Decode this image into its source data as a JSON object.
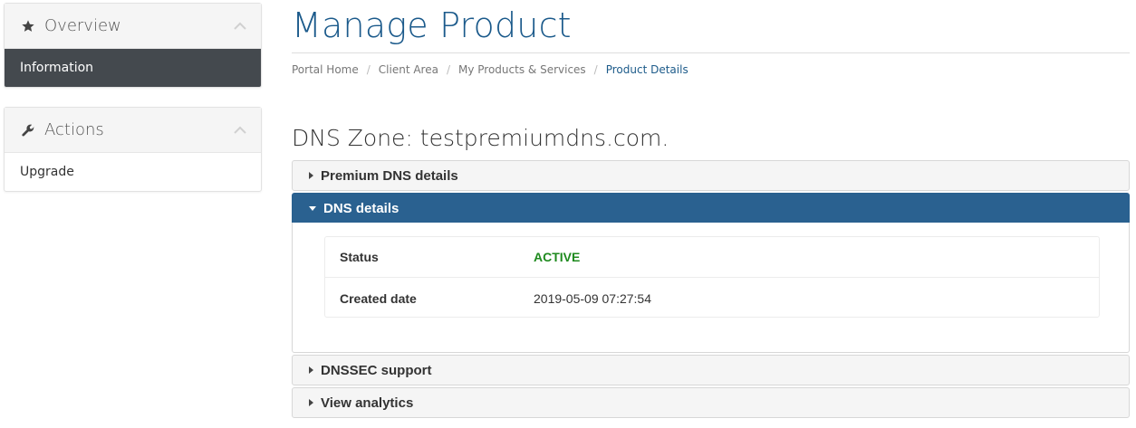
{
  "sidebar": {
    "overview": {
      "title": "Overview",
      "icon": "star-icon",
      "items": [
        "Information"
      ]
    },
    "actions": {
      "title": "Actions",
      "icon": "wrench-icon",
      "items": [
        "Upgrade"
      ]
    }
  },
  "header": {
    "title": "Manage Product",
    "breadcrumb": [
      "Portal Home",
      "Client Area",
      "My Products & Services",
      "Product Details"
    ]
  },
  "main": {
    "zone_title": "DNS Zone: testpremiumdns.com.",
    "sections": [
      {
        "label": "Premium DNS details",
        "expanded": false
      },
      {
        "label": "DNS details",
        "expanded": true
      },
      {
        "label": "DNSSEC support",
        "expanded": false
      },
      {
        "label": "View analytics",
        "expanded": false
      }
    ],
    "details": [
      {
        "key": "Status",
        "value": "ACTIVE"
      },
      {
        "key": "Created date",
        "value": "2019-05-09 07:27:54"
      }
    ]
  },
  "colors": {
    "brand": "#1b5a8b",
    "accordion_active": "#2a6190",
    "sidebar_active": "#44494e",
    "status_active": "#1e8a1e"
  }
}
